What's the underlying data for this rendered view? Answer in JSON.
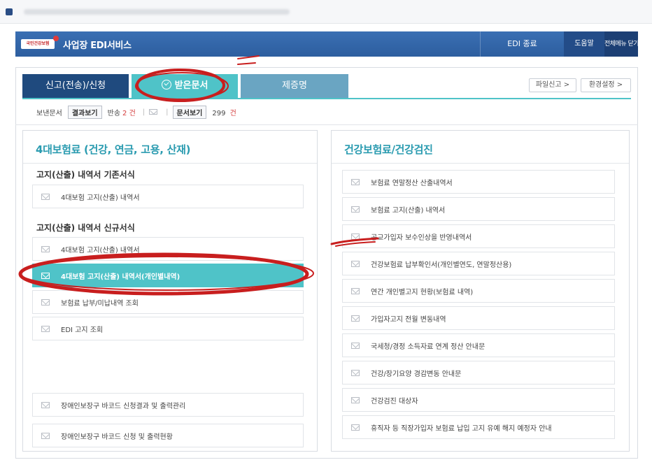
{
  "header": {
    "logo_text": "국민건강보험",
    "service_title": "사업장 EDI서비스",
    "edi_end_label": "EDI 종료",
    "help_label": "도움말",
    "close_all_label": "전체메뉴 닫기"
  },
  "tabs": [
    {
      "label": "신고(전송)/신청"
    },
    {
      "label": "받은문서"
    },
    {
      "label": "제증명"
    }
  ],
  "top_buttons": {
    "file_report": "파일신고 >",
    "env_settings": "환경설정 >"
  },
  "subbar": {
    "sent_docs_label": "보낸문서",
    "result_view_label": "결과보기",
    "returned_label": "반송",
    "returned_count": "2",
    "count_unit": "건",
    "doc_view_label": "문서보기",
    "doc_count": "299",
    "doc_count_unit": "건"
  },
  "left_column": {
    "title": "4대보험료 (건강, 연금, 고용, 산재)",
    "group_existing": "고지(산출) 내역서 기존서식",
    "group_new": "고지(산출) 내역서 신규서식",
    "items_existing": [
      "4대보험 고지(산출) 내역서"
    ],
    "items_new": [
      "4대보험 고지(산출) 내역서",
      "4대보험 고지(산출) 내역서(개인별내역)",
      "보험료 납부/미납내역 조회",
      "EDI 고지 조회"
    ],
    "items_bottom": [
      "장애인보장구 바코드 신청결과 및 출력관리",
      "장애인보장구 바코드 신청 및 출력현황"
    ]
  },
  "right_column": {
    "title": "건강보험료/건강검진",
    "items": [
      "보험료 연말정산 산출내역서",
      "보험료 고지(산출) 내역서",
      "공교가입자 보수인상을 반영내역서",
      "건강보험료 납부확인서(개인별연도, 연말정산용)",
      "연간 개인별고지 현황(보험료 내역)",
      "가입자고지 전월 변동내역",
      "국세청/경정 소득자료 연계 정산 안내문",
      "건강/장기요양 경감변동 안내문",
      "건강검진 대상자",
      "휴직자 등 직장가입자 보험료 납입 고지 유예 해지 예정자 안내"
    ]
  },
  "colors": {
    "accent": "#4fc3c8",
    "header_blue": "#2d5e9f",
    "tab_dark": "#1f4a7e",
    "annotation_red": "#c81e1e"
  }
}
